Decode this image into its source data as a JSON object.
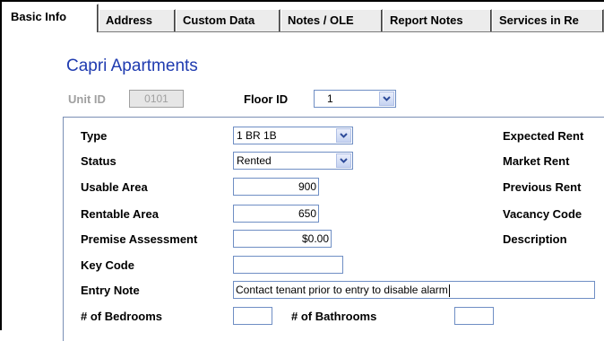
{
  "tabs": [
    {
      "label": "Basic Info"
    },
    {
      "label": "Address"
    },
    {
      "label": "Custom Data"
    },
    {
      "label": "Notes / OLE"
    },
    {
      "label": "Report Notes"
    },
    {
      "label": "Services in Re"
    }
  ],
  "property": {
    "name": "Capri Apartments"
  },
  "unit": {
    "unit_id_label": "Unit ID",
    "unit_id_value": "0101",
    "floor_id_label": "Floor ID",
    "floor_id_value": "1"
  },
  "fields": {
    "type": {
      "label": "Type",
      "value": "1 BR 1B"
    },
    "status": {
      "label": "Status",
      "value": "Rented"
    },
    "usable_area": {
      "label": "Usable Area",
      "value": "900"
    },
    "rentable_area": {
      "label": "Rentable Area",
      "value": "650"
    },
    "premise_assessment": {
      "label": "Premise Assessment",
      "value": "$0.00"
    },
    "key_code": {
      "label": "Key Code",
      "value": ""
    },
    "entry_note": {
      "label": "Entry Note",
      "value": "Contact tenant prior to entry to disable alarm"
    },
    "bedrooms": {
      "label": "# of Bedrooms",
      "value": ""
    },
    "bathrooms": {
      "label": "# of Bathrooms",
      "value": ""
    }
  },
  "right_labels": [
    "Expected Rent",
    "Market Rent",
    "Previous Rent",
    "Vacancy Code",
    "Description"
  ],
  "colors": {
    "title": "#1f3bb0",
    "input_border": "#6f8ec4",
    "disabled_text": "#a0a0a0"
  }
}
